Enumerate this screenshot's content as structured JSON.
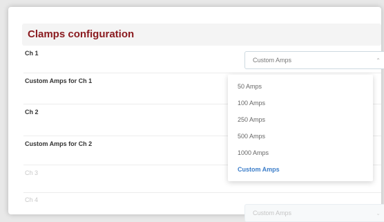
{
  "page": {
    "title": "Clamps configuration"
  },
  "rows": [
    {
      "label": "Ch 1",
      "disabled": false
    },
    {
      "label": "Custom Amps for Ch 1",
      "disabled": false
    },
    {
      "label": "Ch 2",
      "disabled": false
    },
    {
      "label": "Custom Amps for Ch 2",
      "disabled": false
    },
    {
      "label": "Ch 3",
      "disabled": true
    },
    {
      "label": "Ch 4",
      "disabled": true
    }
  ],
  "ch1_select": {
    "value": "Custom Amps",
    "open": true
  },
  "ch4_select": {
    "value": "Custom Amps",
    "disabled": true
  },
  "dropdown": {
    "options": [
      "50 Amps",
      "100 Amps",
      "250 Amps",
      "500 Amps",
      "1000 Amps",
      "Custom Amps"
    ],
    "selected": "Custom Amps"
  },
  "colors": {
    "title": "#8a1a1f",
    "selected_option": "#3b7dc9"
  },
  "icons": {
    "chevron": "chevron-down-icon"
  }
}
